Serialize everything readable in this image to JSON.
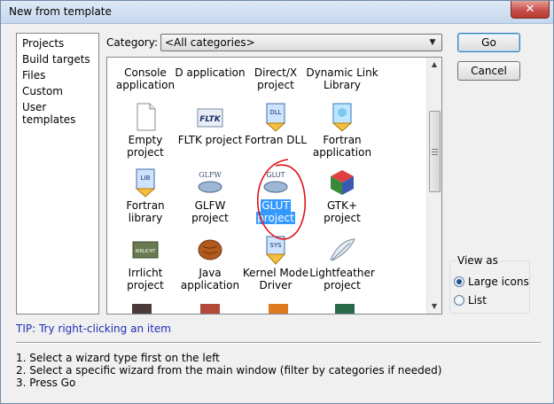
{
  "window": {
    "title": "New from template",
    "close_glyph": "✕"
  },
  "left_list": {
    "items": [
      "Projects",
      "Build targets",
      "Files",
      "Custom",
      "User templates"
    ]
  },
  "category": {
    "label": "Category:",
    "selected": "<All categories>"
  },
  "templates": [
    {
      "label": [
        "Console",
        "application"
      ],
      "icon": "console-icon"
    },
    {
      "label": [
        "D application"
      ],
      "icon": "d-app-icon"
    },
    {
      "label": [
        "Direct/X",
        "project"
      ],
      "icon": "directx-icon"
    },
    {
      "label": [
        "Dynamic Link",
        "Library"
      ],
      "icon": "dll-icon"
    },
    {
      "label": [
        "Empty",
        "project"
      ],
      "icon": "empty-project-icon"
    },
    {
      "label": [
        "FLTK project"
      ],
      "icon": "fltk-icon",
      "icon_text": "FLTK"
    },
    {
      "label": [
        "Fortran DLL"
      ],
      "icon": "fortran-dll-icon",
      "icon_text": "DLL"
    },
    {
      "label": [
        "Fortran",
        "application"
      ],
      "icon": "fortran-app-icon"
    },
    {
      "label": [
        "Fortran",
        "library"
      ],
      "icon": "fortran-lib-icon",
      "icon_text": "LIB"
    },
    {
      "label": [
        "GLFW",
        "project"
      ],
      "icon": "glfw-icon",
      "icon_text": "GLFW"
    },
    {
      "label": [
        "GLUT",
        "project"
      ],
      "icon": "glut-icon",
      "icon_text": "GLUT",
      "selected": true
    },
    {
      "label": [
        "GTK+",
        "project"
      ],
      "icon": "gtk-icon"
    },
    {
      "label": [
        "Irrlicht",
        "project"
      ],
      "icon": "irrlicht-icon",
      "icon_text": "IRRLICHT"
    },
    {
      "label": [
        "Java",
        "application"
      ],
      "icon": "java-icon"
    },
    {
      "label": [
        "Kernel Mode",
        "Driver"
      ],
      "icon": "kernel-driver-icon",
      "icon_text": "SYS"
    },
    {
      "label": [
        "Lightfeather",
        "project"
      ],
      "icon": "lightfeather-icon"
    }
  ],
  "buttons": {
    "go": "Go",
    "cancel": "Cancel"
  },
  "view_as": {
    "legend": "View as",
    "large": "Large icons",
    "list": "List",
    "selected": "large"
  },
  "tip": "TIP: Try right-clicking an item",
  "instructions": [
    "1. Select a wizard type first on the left",
    "2. Select a specific wizard from the main window (filter by categories if needed)",
    "3. Press Go"
  ],
  "colors": {
    "selection": "#3399ff",
    "tip": "#1e2fb4",
    "annotation": "#e0101a"
  }
}
